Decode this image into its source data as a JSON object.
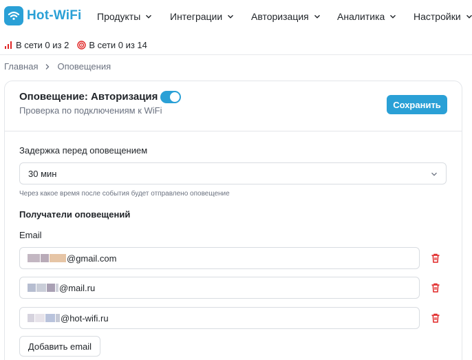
{
  "brand": {
    "name": "Hot-WiFi",
    "color": "#2aa0d6"
  },
  "nav": {
    "items": [
      {
        "label": "Продукты"
      },
      {
        "label": "Интеграции"
      },
      {
        "label": "Авторизация"
      },
      {
        "label": "Аналитика"
      },
      {
        "label": "Настройки"
      }
    ]
  },
  "status": {
    "signal": "В сети 0 из 2",
    "target": "В сети 0 из 14"
  },
  "breadcrumb": {
    "home": "Главная",
    "current": "Оповещения"
  },
  "card": {
    "title": "Оповещение: Авторизация",
    "subtitle": "Проверка по подключениям к WiFi",
    "toggle_on": true,
    "save_label": "Сохранить",
    "delay_label": "Задержка перед оповещением",
    "delay_value": "30 мин",
    "delay_hint": "Через какое время после события будет отправлено оповещение",
    "recipients_label": "Получатели оповещений",
    "email_label": "Email",
    "emails": [
      {
        "visible_part": "@gmail.com"
      },
      {
        "visible_part": "@mail.ru"
      },
      {
        "visible_part": "@hot-wifi.ru"
      }
    ],
    "add_email_label": "Добавить email"
  },
  "colors": {
    "accent": "#2aa0d6",
    "danger": "#e02424"
  }
}
